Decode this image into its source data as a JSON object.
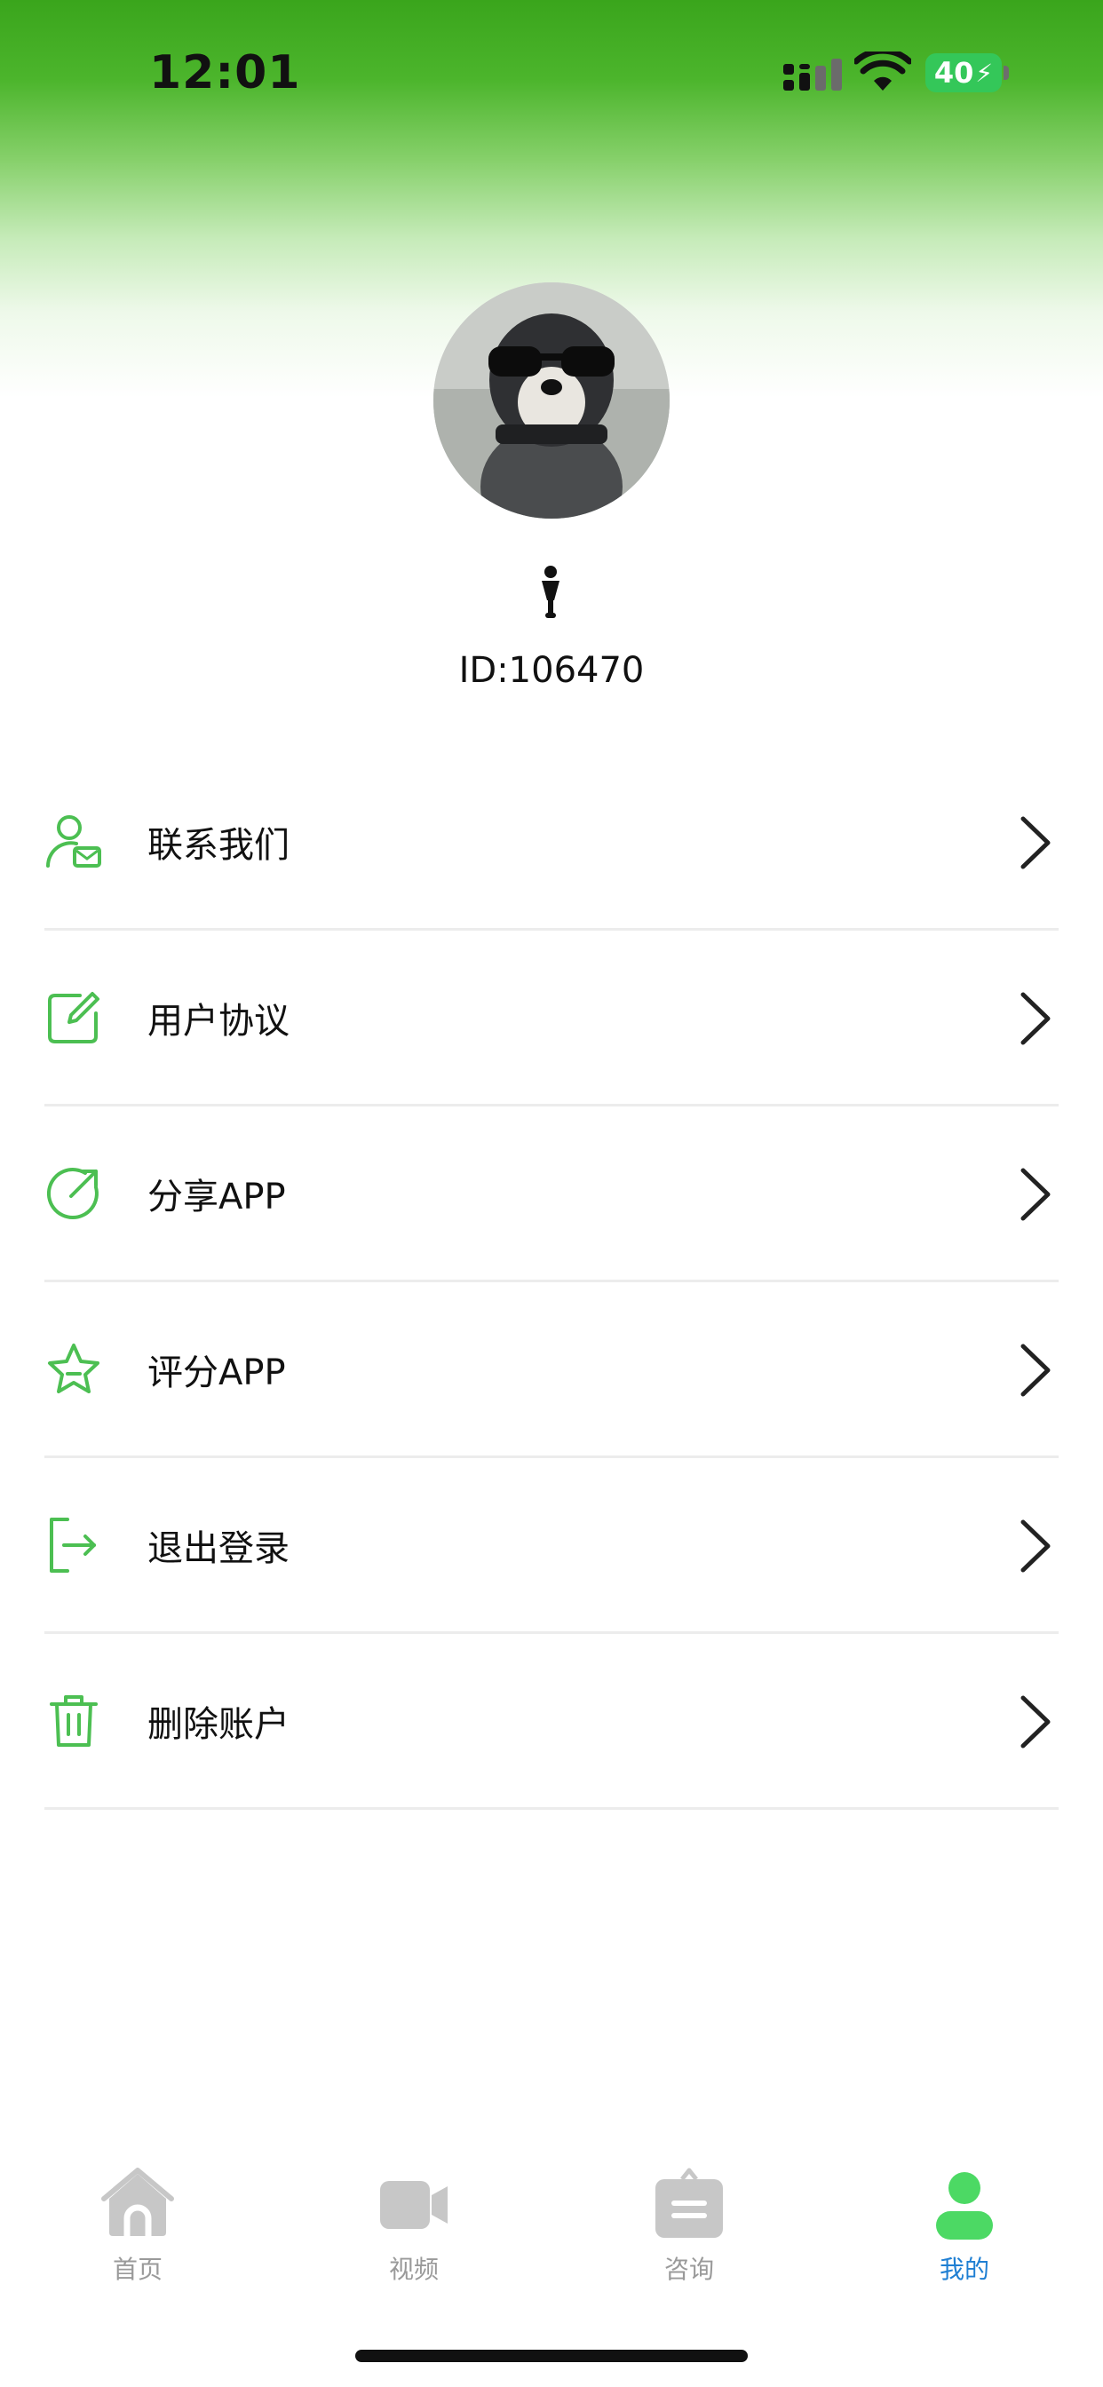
{
  "status_bar": {
    "time": "12:01",
    "battery": "40",
    "icons": [
      "signal-icon",
      "wifi-icon",
      "battery-icon"
    ]
  },
  "profile": {
    "avatar": "avatar-dog-photo",
    "id_text": "ID:106470"
  },
  "menu": {
    "items": [
      {
        "label": "联系我们",
        "icon": "contact-mail-icon"
      },
      {
        "label": "用户协议",
        "icon": "edit-document-icon"
      },
      {
        "label": "分享APP",
        "icon": "share-icon"
      },
      {
        "label": "评分APP",
        "icon": "star-icon"
      },
      {
        "label": "退出登录",
        "icon": "logout-icon"
      },
      {
        "label": "删除账户",
        "icon": "trash-icon"
      }
    ],
    "chevron_icon": "chevron-right-icon"
  },
  "tabbar": {
    "tabs": [
      {
        "label": "首页",
        "icon": "home-icon",
        "active": false
      },
      {
        "label": "视频",
        "icon": "video-icon",
        "active": false
      },
      {
        "label": "咨询",
        "icon": "consult-icon",
        "active": false
      },
      {
        "label": "我的",
        "icon": "profile-icon",
        "active": true
      }
    ]
  },
  "colors": {
    "accent": "#4cbf52",
    "header_green": "#3aa51c",
    "active_tab_text": "#1f7fd3",
    "inactive_tab": "#c7c7c7",
    "divider": "#ececec"
  }
}
